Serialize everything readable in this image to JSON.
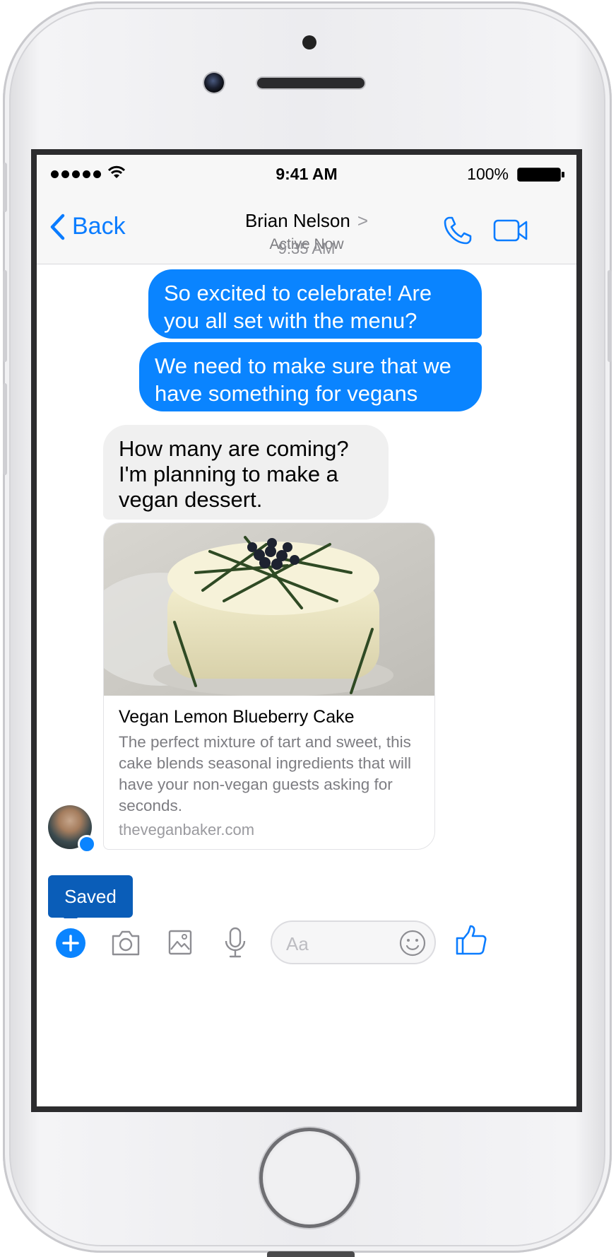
{
  "status_bar": {
    "time": "9:41 AM",
    "battery": "100%"
  },
  "nav": {
    "back_label": "Back",
    "contact_name": "Brian Nelson",
    "contact_status": "Active Now",
    "chevron": ">"
  },
  "conversation": {
    "timestamp": "9:35 AM",
    "messages": [
      {
        "from": "me",
        "text": "So excited to celebrate! Are you all set with the menu?"
      },
      {
        "from": "me",
        "text": "We need to make sure that we have something for vegans too..."
      },
      {
        "from": "them",
        "text": "How many are coming? I'm planning to make a vegan dessert."
      }
    ],
    "link_card": {
      "title": "Vegan Lemon Blueberry Cake",
      "description": "The perfect mixture of tart and sweet, this cake blends seasonal ingredients that will have your non-vegan guests asking for seconds.",
      "domain": "theveganbaker.com"
    }
  },
  "tooltip": {
    "label": "Saved"
  },
  "composer": {
    "placeholder": "Aa",
    "value": ""
  },
  "colors": {
    "accent": "#0a84ff",
    "tooltip": "#0a5db8"
  },
  "icons": [
    "back-chevron-icon",
    "phone-icon",
    "video-camera-icon",
    "plus-icon",
    "camera-icon",
    "image-icon",
    "microphone-icon",
    "smiley-icon",
    "thumbs-up-icon",
    "wifi-icon",
    "battery-icon",
    "messenger-badge-icon"
  ]
}
